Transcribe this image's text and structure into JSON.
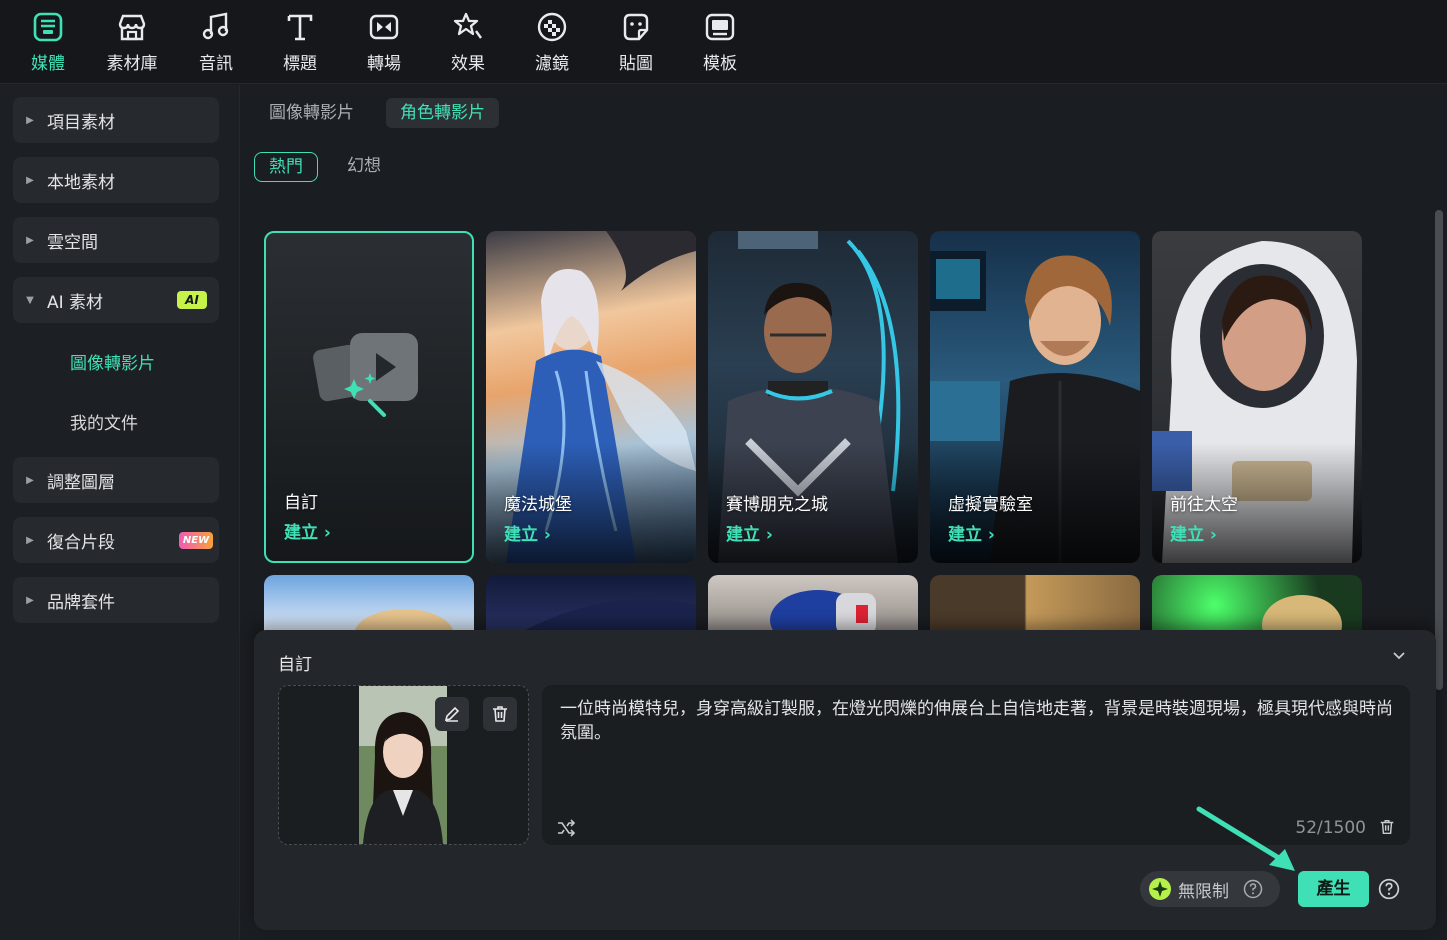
{
  "toolbar": {
    "items": [
      {
        "label": "媒體",
        "icon": "media-icon"
      },
      {
        "label": "素材庫",
        "icon": "stock-icon"
      },
      {
        "label": "音訊",
        "icon": "music-icon"
      },
      {
        "label": "標題",
        "icon": "title-icon"
      },
      {
        "label": "轉場",
        "icon": "transition-icon"
      },
      {
        "label": "效果",
        "icon": "effects-icon"
      },
      {
        "label": "濾鏡",
        "icon": "filter-icon"
      },
      {
        "label": "貼圖",
        "icon": "sticker-icon"
      },
      {
        "label": "模板",
        "icon": "template-icon"
      }
    ],
    "active_index": 0,
    "accent": "#3fe0b6"
  },
  "sidebar": {
    "items": [
      {
        "label": "項目素材"
      },
      {
        "label": "本地素材"
      },
      {
        "label": "雲空間"
      },
      {
        "label": "AI 素材",
        "badge": "AI",
        "expanded": true
      },
      {
        "label": "調整圖層"
      },
      {
        "label": "復合片段",
        "badge": "NEW"
      },
      {
        "label": "品牌套件"
      }
    ],
    "sub_items": [
      {
        "label": "圖像轉影片",
        "active": true
      },
      {
        "label": "我的文件"
      }
    ]
  },
  "main": {
    "tabs": [
      {
        "label": "圖像轉影片"
      },
      {
        "label": "角色轉影片",
        "active": true
      }
    ],
    "chips": [
      {
        "label": "熱門",
        "active": true
      },
      {
        "label": "幻想"
      }
    ],
    "cards": [
      {
        "title": "自訂",
        "cta": "建立 ›",
        "selected": true
      },
      {
        "title": "魔法城堡",
        "cta": "建立 ›"
      },
      {
        "title": "賽博朋克之城",
        "cta": "建立 ›"
      },
      {
        "title": "虛擬實驗室",
        "cta": "建立 ›"
      },
      {
        "title": "前往太空",
        "cta": "建立 ›"
      }
    ]
  },
  "panel": {
    "title": "自訂",
    "prompt": "一位時尚模特兒，身穿高級訂製服，在燈光閃爍的伸展台上自信地走著，背景是時裝週現場，極具現代感與時尚氛圍。",
    "count": "52/1500",
    "unlimited_label": "無限制",
    "generate_label": "產生"
  }
}
